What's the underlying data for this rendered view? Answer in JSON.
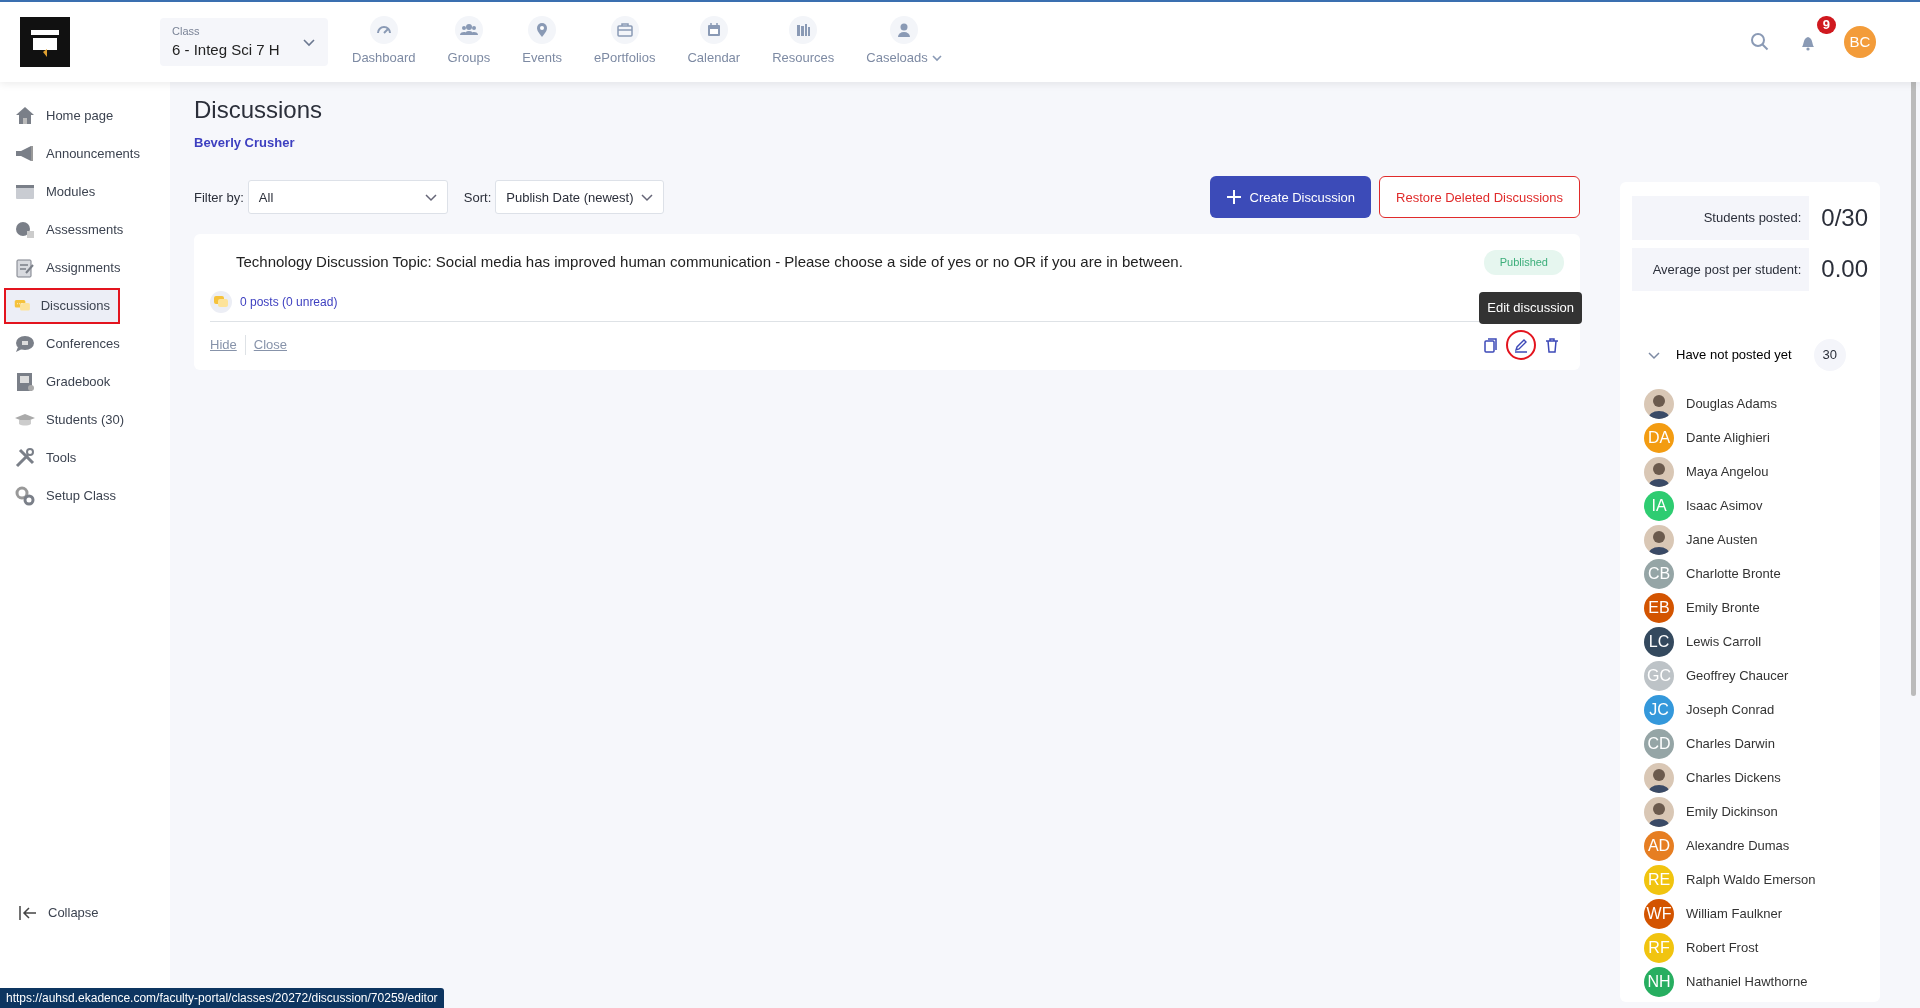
{
  "header": {
    "class_label": "Class",
    "class_value": "6 - Integ Sci 7 H",
    "nav": [
      {
        "label": "Dashboard",
        "dropdown": false
      },
      {
        "label": "Groups",
        "dropdown": false
      },
      {
        "label": "Events",
        "dropdown": false
      },
      {
        "label": "ePortfolios",
        "dropdown": false
      },
      {
        "label": "Calendar",
        "dropdown": false
      },
      {
        "label": "Resources",
        "dropdown": false
      },
      {
        "label": "Caseloads",
        "dropdown": true
      }
    ],
    "notification_count": "9",
    "avatar_initials": "BC"
  },
  "sidebar": {
    "items": [
      {
        "label": "Home page",
        "selected": false,
        "highlighted": false
      },
      {
        "label": "Announcements",
        "selected": false,
        "highlighted": false
      },
      {
        "label": "Modules",
        "selected": false,
        "highlighted": false
      },
      {
        "label": "Assessments",
        "selected": false,
        "highlighted": false
      },
      {
        "label": "Assignments",
        "selected": false,
        "highlighted": false
      },
      {
        "label": "Discussions",
        "selected": true,
        "highlighted": true
      },
      {
        "label": "Conferences",
        "selected": false,
        "highlighted": false
      },
      {
        "label": "Gradebook",
        "selected": false,
        "highlighted": false
      },
      {
        "label": "Students (30)",
        "selected": false,
        "highlighted": false
      },
      {
        "label": "Tools",
        "selected": false,
        "highlighted": false
      },
      {
        "label": "Setup Class",
        "selected": false,
        "highlighted": false
      }
    ],
    "collapse_label": "Collapse"
  },
  "page": {
    "title": "Discussions",
    "teacher": "Beverly Crusher",
    "filter": {
      "label": "Filter by:",
      "value": "All"
    },
    "sort": {
      "label": "Sort:",
      "value": "Publish Date (newest)"
    },
    "buttons": [
      {
        "label": "Create Discussion",
        "kind": "primary"
      },
      {
        "label": "Restore Deleted Discussions",
        "kind": "danger-outline"
      }
    ],
    "discussions": [
      {
        "title": "Technology Discussion Topic: Social media has improved human communication - Please choose a side of yes or no OR if you are in between.",
        "status": "Published",
        "posts": "0 posts (0 unread)",
        "links": [
          "Hide",
          "Close"
        ],
        "actions": [
          {
            "kind": "copy",
            "highlighted": false
          },
          {
            "kind": "edit",
            "highlighted": true
          },
          {
            "kind": "delete",
            "highlighted": false
          }
        ],
        "tooltip": "Edit discussion"
      }
    ]
  },
  "stats": {
    "rows": [
      {
        "label": "Students posted:",
        "value": "0/30"
      },
      {
        "label": "Average post per student:",
        "value": "0.00"
      }
    ],
    "group": {
      "label": "Have not posted yet",
      "count": "30",
      "expanded": true
    },
    "students": [
      {
        "name": "Douglas Adams"
      },
      {
        "name": "Dante Alighieri",
        "kind": "initials",
        "initials": "DA",
        "color": "#f39c12"
      },
      {
        "name": "Maya Angelou"
      },
      {
        "name": "Isaac Asimov",
        "kind": "initials",
        "initials": "IA",
        "color": "#2ecc71"
      },
      {
        "name": "Jane Austen"
      },
      {
        "name": "Charlotte Bronte",
        "kind": "initials",
        "initials": "CB",
        "color": "#95a5a6"
      },
      {
        "name": "Emily Bronte",
        "kind": "initials",
        "initials": "EB",
        "color": "#d35400"
      },
      {
        "name": "Lewis Carroll",
        "kind": "initials",
        "initials": "LC",
        "color": "#34495e"
      },
      {
        "name": "Geoffrey Chaucer",
        "kind": "initials",
        "initials": "GC",
        "color": "#bdc3c7"
      },
      {
        "name": "Joseph Conrad",
        "kind": "initials",
        "initials": "JC",
        "color": "#3498db"
      },
      {
        "name": "Charles Darwin",
        "kind": "initials",
        "initials": "CD",
        "color": "#95a5a6"
      },
      {
        "name": "Charles Dickens"
      },
      {
        "name": "Emily Dickinson"
      },
      {
        "name": "Alexandre Dumas",
        "kind": "initials",
        "initials": "AD",
        "color": "#e67e22"
      },
      {
        "name": "Ralph Waldo Emerson",
        "kind": "initials",
        "initials": "RE",
        "color": "#f1c40f"
      },
      {
        "name": "William Faulkner",
        "kind": "initials",
        "initials": "WF",
        "color": "#d35400"
      },
      {
        "name": "Robert Frost",
        "kind": "initials",
        "initials": "RF",
        "color": "#f1c40f"
      },
      {
        "name": "Nathaniel Hawthorne",
        "kind": "initials",
        "initials": "NH",
        "color": "#27ae60"
      }
    ]
  },
  "status_bar": "https://auhsd.ekadence.com/faculty-portal/classes/20272/discussion/70259/editor"
}
